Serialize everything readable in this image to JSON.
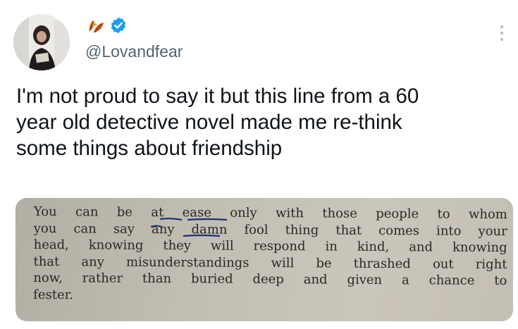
{
  "tweet": {
    "handle": "@Lovandfear",
    "text_lines": [
      "I'm not proud to say it but this line from a 60",
      "year old detective novel made me re-think",
      "some things about friendship"
    ],
    "verified_color": "#1d9bf0",
    "name_icon": "autumn-leaves-icon",
    "more_icon": "more-options-icon"
  },
  "media": {
    "book_lines": [
      "You can be at ease only with those people to whom",
      "you can say any damn fool thing that comes into your",
      "head, knowing they will respond in kind, and knowing",
      "that any misunderstandings will be thrashed out right",
      "now, rather than buried deep and given a chance to",
      "fester."
    ]
  }
}
